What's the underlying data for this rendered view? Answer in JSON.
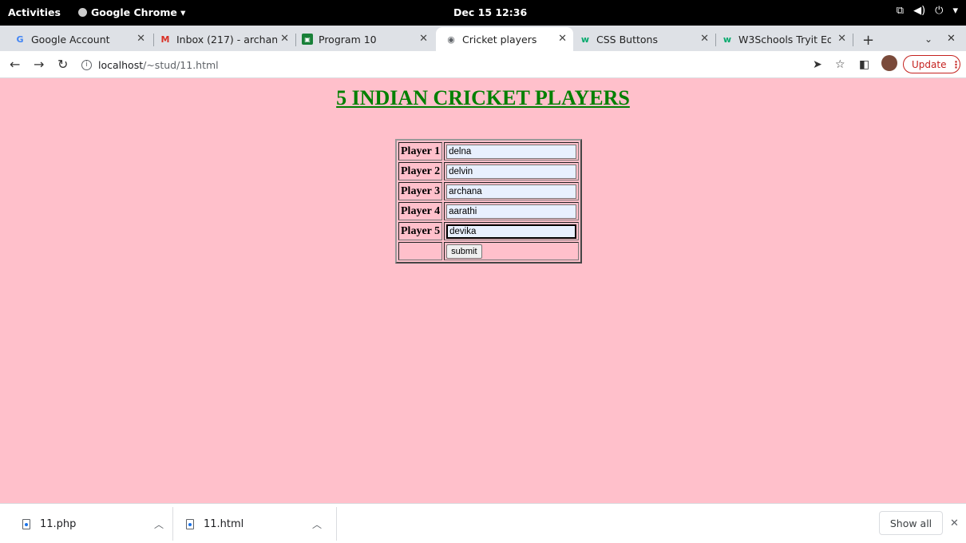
{
  "topbar": {
    "activities": "Activities",
    "app_name": "Google Chrome ▾",
    "clock": "Dec 15  12:36",
    "sys_icons": [
      "network-icon",
      "volume-icon",
      "power-icon",
      "menu-arrow-icon"
    ]
  },
  "tabs": [
    {
      "label": "Google Account",
      "icon": "G",
      "icon_color": "#4285f4"
    },
    {
      "label": "Inbox (217) - archan",
      "icon": "M",
      "icon_color": "#d93025"
    },
    {
      "label": "Program 10",
      "icon": "▪",
      "icon_color": "#188038"
    },
    {
      "label": "Cricket players",
      "icon": "◉",
      "icon_color": "#5f6368"
    },
    {
      "label": "CSS Buttons",
      "icon": "w",
      "icon_color": "#04aa6d"
    },
    {
      "label": "W3Schools Tryit Ed",
      "icon": "w",
      "icon_color": "#04aa6d"
    }
  ],
  "toolbar": {
    "url_host": "localhost",
    "url_path": "/~stud/11.html",
    "update_label": "Update"
  },
  "page": {
    "title": "5 INDIAN CRICKET PLAYERS",
    "background": "#ffc0cb",
    "title_color": "#008000",
    "rows": [
      {
        "label": "Player 1",
        "value": "delna"
      },
      {
        "label": "Player 2",
        "value": "delvin"
      },
      {
        "label": "Player 3",
        "value": "archana"
      },
      {
        "label": "Player 4",
        "value": "aarathi"
      },
      {
        "label": "Player 5",
        "value": "devika"
      }
    ],
    "submit_label": "submit"
  },
  "downloads": {
    "items": [
      "11.php",
      "11.html"
    ],
    "show_all": "Show all"
  }
}
